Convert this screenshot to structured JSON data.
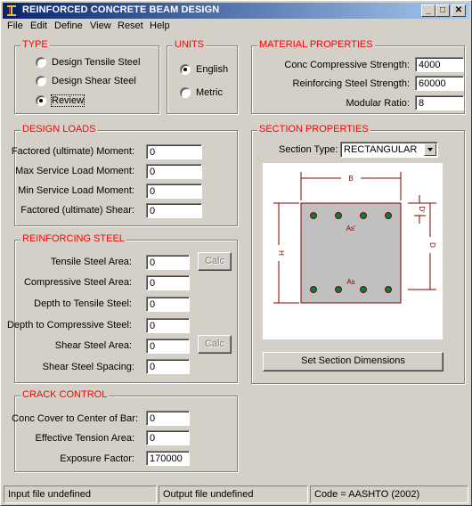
{
  "window": {
    "title": "REINFORCED CONCRETE BEAM DESIGN",
    "app_icon": "i-beam-icon",
    "controls": {
      "minimize": "_",
      "maximize": "□",
      "close": "✕"
    }
  },
  "menu": [
    "File",
    "Edit",
    "Define",
    "View",
    "Reset",
    "Help"
  ],
  "type_group": {
    "title": "TYPE",
    "options": [
      {
        "label": "Design Tensile Steel",
        "checked": false
      },
      {
        "label": "Design Shear Steel",
        "checked": false
      },
      {
        "label": "Review",
        "checked": true
      }
    ]
  },
  "units_group": {
    "title": "UNITS",
    "options": [
      {
        "label": "English",
        "checked": true
      },
      {
        "label": "Metric",
        "checked": false
      }
    ]
  },
  "material": {
    "title": "MATERIAL PROPERTIES",
    "fields": [
      {
        "label": "Conc Compressive Strength:",
        "value": "4000"
      },
      {
        "label": "Reinforcing Steel Strength:",
        "value": "60000"
      },
      {
        "label": "Modular Ratio:",
        "value": "8"
      }
    ]
  },
  "design_loads": {
    "title": "DESIGN LOADS",
    "fields": [
      {
        "label": "Factored (ultimate) Moment:",
        "value": "0"
      },
      {
        "label": "Max Service Load Moment:",
        "value": "0"
      },
      {
        "label": "Min Service Load Moment:",
        "value": "0"
      },
      {
        "label": "Factored (ultimate) Shear:",
        "value": "0"
      }
    ]
  },
  "section": {
    "title": "SECTION PROPERTIES",
    "type_label": "Section Type:",
    "type_value": "RECTANGULAR",
    "diagram_labels": {
      "B": "B",
      "H": "H",
      "D": "D",
      "Dprime": "D'",
      "As": "As",
      "As_prime": "As'"
    },
    "set_dims_button": "Set Section Dimensions",
    "colors": {
      "section_fill": "#c0c0c0",
      "dimension_line": "#800000",
      "rebar": "#008040"
    }
  },
  "reinforcing": {
    "title": "REINFORCING STEEL",
    "fields": [
      {
        "label": "Tensile Steel Area:",
        "value": "0"
      },
      {
        "label": "Compressive Steel Area:",
        "value": "0"
      },
      {
        "label": "Depth to Tensile Steel:",
        "value": "0"
      },
      {
        "label": "Depth to Compressive Steel:",
        "value": "0"
      },
      {
        "label": "Shear Steel Area:",
        "value": "0"
      },
      {
        "label": "Shear Steel Spacing:",
        "value": "0"
      }
    ],
    "calc_label": "Calc"
  },
  "crack": {
    "title": "CRACK CONTROL",
    "fields": [
      {
        "label": "Conc Cover to Center of Bar:",
        "value": "0"
      },
      {
        "label": "Effective Tension Area:",
        "value": "0"
      },
      {
        "label": "Exposure Factor:",
        "value": "170000"
      }
    ]
  },
  "status": {
    "input_file": "Input file undefined",
    "output_file": "Output file undefined",
    "code": "Code = AASHTO (2002)"
  }
}
